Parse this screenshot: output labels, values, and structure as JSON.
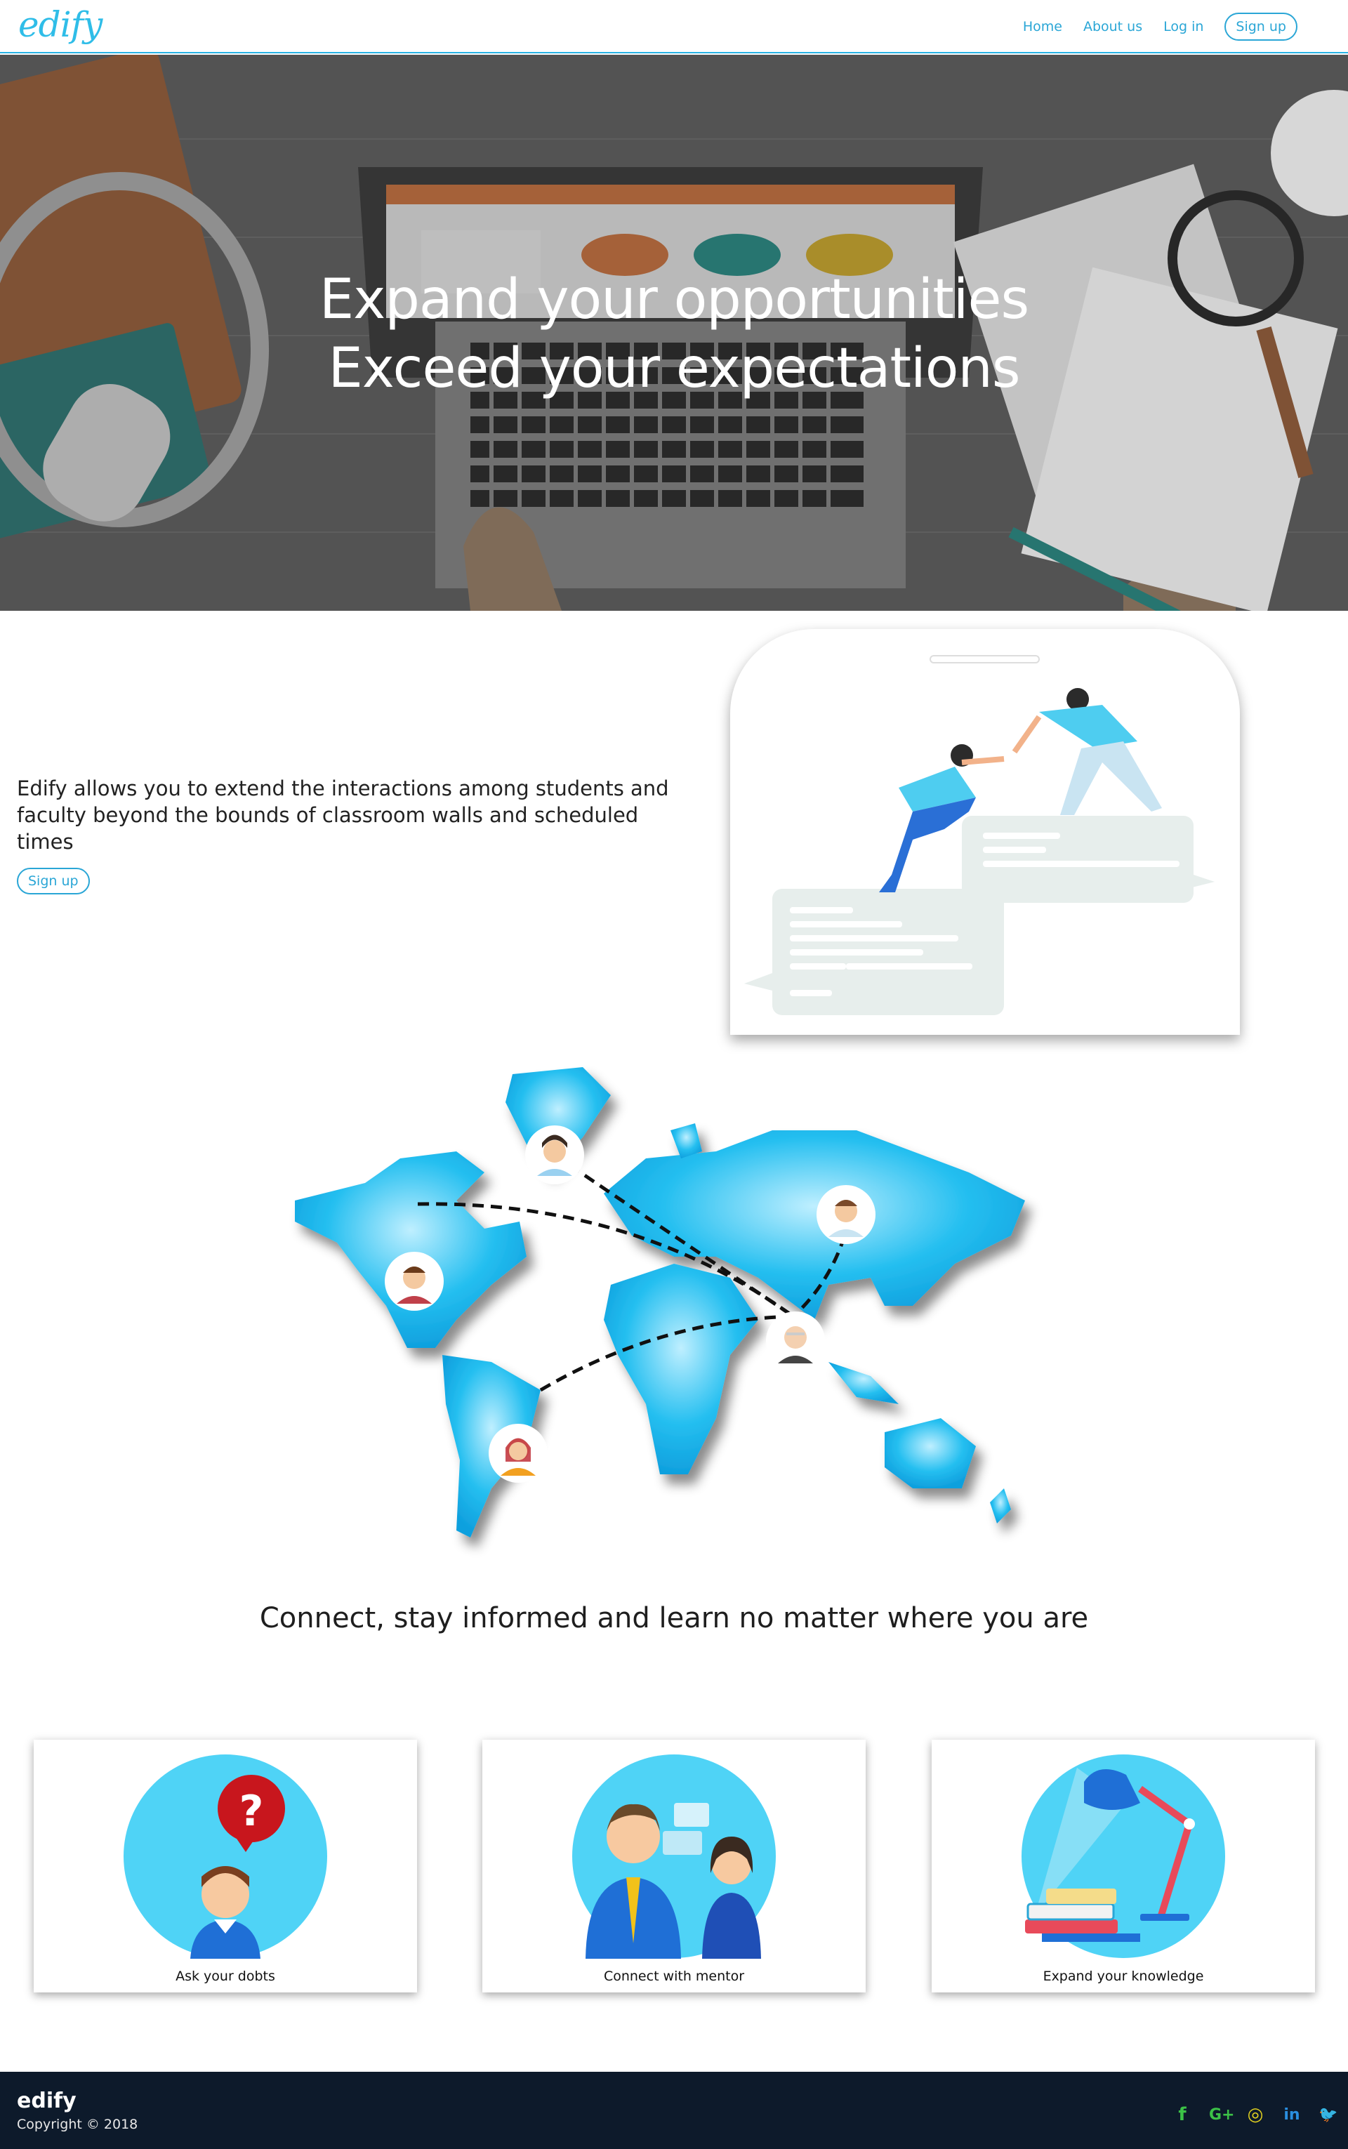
{
  "nav": {
    "logo": "edify",
    "links": [
      "Home",
      "About us",
      "Log in"
    ],
    "signup": "Sign up"
  },
  "hero": {
    "line1": "Expand your opportunities",
    "line2": "Exceed your expectations"
  },
  "intro": {
    "text": "Edify allows you to extend the interactions among students and faculty beyond the bounds of classroom walls and scheduled times",
    "signup": "Sign up"
  },
  "connect": {
    "title": "Connect, stay informed and learn no matter where you are"
  },
  "cards": [
    {
      "label": "Ask your dobts",
      "icon": "question-avatar-icon"
    },
    {
      "label": "Connect with mentor",
      "icon": "mentor-chat-icon"
    },
    {
      "label": "Expand your knowledge",
      "icon": "desk-lamp-books-icon"
    }
  ],
  "footer": {
    "brand": "edify",
    "copyright": "Copyright © 2018",
    "socials": [
      {
        "name": "facebook-icon",
        "glyph": "f",
        "color": "#3cc247"
      },
      {
        "name": "google-plus-icon",
        "glyph": "G+",
        "color": "#3cc247"
      },
      {
        "name": "instagram-icon",
        "glyph": "◎",
        "color": "#e3d21f"
      },
      {
        "name": "linkedin-icon",
        "glyph": "in",
        "color": "#2a8fe0"
      },
      {
        "name": "twitter-icon",
        "glyph": "🐦",
        "color": "#e83fb1"
      }
    ]
  },
  "colors": {
    "accent": "#2aa6d6",
    "footer_bg": "#0d1a2b",
    "map_blue": "#1fb3ec"
  }
}
